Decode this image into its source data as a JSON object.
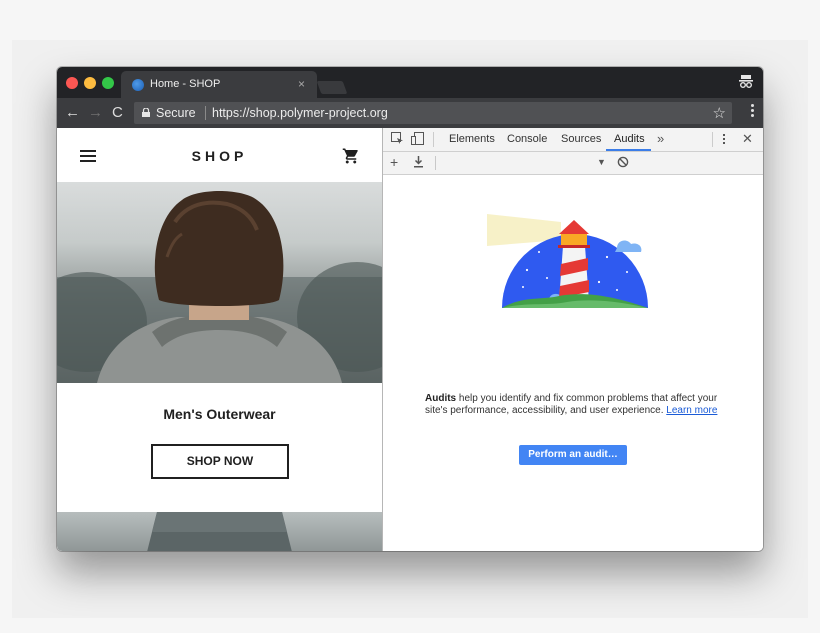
{
  "browser": {
    "tab_title": "Home - SHOP",
    "tab_close": "×",
    "back": "←",
    "forward": "→",
    "reload": "C",
    "secure_label": "Secure",
    "url": "https://shop.polymer-project.org",
    "star": "☆"
  },
  "shop": {
    "brand": "SHOP",
    "category_title": "Men's Outerwear",
    "cta_label": "SHOP NOW"
  },
  "devtools": {
    "tabs": [
      "Elements",
      "Console",
      "Sources",
      "Audits"
    ],
    "active_tab": "Audits",
    "more": "»",
    "close": "✕",
    "add": "+",
    "dropdown": "▼",
    "audits_bold": "Audits",
    "audits_body": " help you identify and fix common problems that affect your site's performance, accessibility, and user experience. ",
    "learn_more": "Learn more",
    "perform_button": "Perform an audit…"
  },
  "colors": {
    "titlebar": "#222326",
    "toolbar": "#3b3c3f",
    "accent": "#4285f4",
    "active_tab_underline": "#3b7de8"
  },
  "icons": [
    "hamburger-icon",
    "cart-icon",
    "lock-icon",
    "star-icon",
    "inspect-icon",
    "device-icon",
    "download-icon",
    "block-icon",
    "incognito-icon"
  ]
}
